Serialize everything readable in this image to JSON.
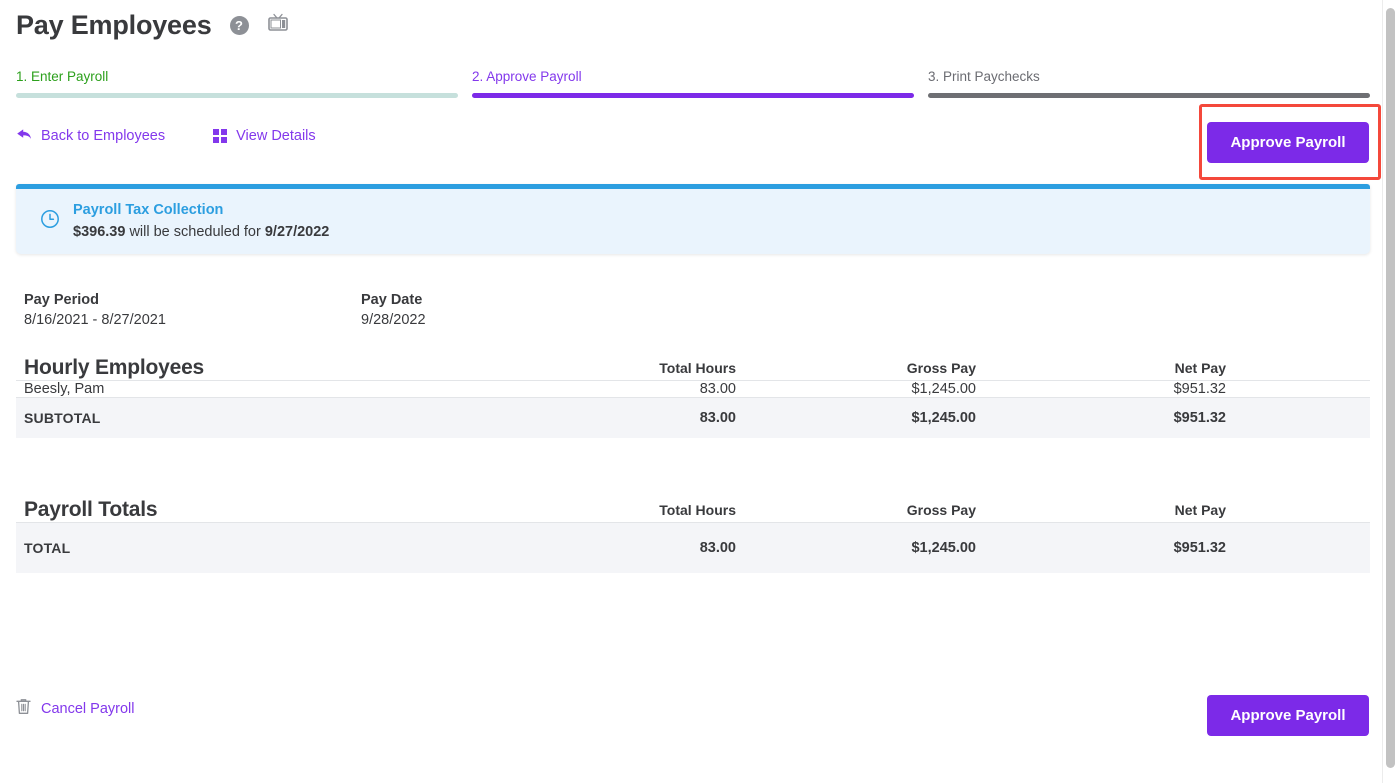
{
  "header": {
    "title": "Pay Employees",
    "help_icon": "help-circle-icon",
    "video_icon": "tutorial-video-icon",
    "help_glyph": "?"
  },
  "steps": [
    {
      "label": "1. Enter Payroll",
      "state": "complete",
      "color": "#2ca01c",
      "bar_color": "#c6e0dc"
    },
    {
      "label": "2. Approve Payroll",
      "state": "current",
      "color": "#8338ec",
      "bar_color": "#7c2ae8"
    },
    {
      "label": "3. Print Paychecks",
      "state": "upcoming",
      "color": "#6b6c72",
      "bar_color": "#6e6f73"
    }
  ],
  "action_bar": {
    "back_label": "Back to Employees",
    "back_icon": "back-arrow-icon",
    "view_details_label": "View Details",
    "view_details_icon": "grid-icon",
    "approve_label": "Approve Payroll"
  },
  "highlight": {
    "target": "approve-payroll-button",
    "color": "#f4483b"
  },
  "banner": {
    "icon": "clock-icon",
    "title": "Payroll Tax Collection",
    "amount": "$396.39",
    "middle_text": " will be scheduled for ",
    "date": "9/27/2022",
    "accent_color": "#2c9ee0",
    "background": "#eaf4fd"
  },
  "pay_info": {
    "period_label": "Pay Period",
    "period_value": "8/16/2021 - 8/27/2021",
    "date_label": "Pay Date",
    "date_value": "9/28/2022"
  },
  "hourly_table": {
    "title": "Hourly Employees",
    "columns": [
      "Total Hours",
      "Gross Pay",
      "Net Pay"
    ],
    "rows": [
      {
        "name": "Beesly, Pam",
        "hours": "83.00",
        "gross": "$1,245.00",
        "net": "$951.32"
      }
    ],
    "subtotal": {
      "name": "SUBTOTAL",
      "hours": "83.00",
      "gross": "$1,245.00",
      "net": "$951.32"
    }
  },
  "totals_table": {
    "title": "Payroll Totals",
    "columns": [
      "Total Hours",
      "Gross Pay",
      "Net Pay"
    ],
    "total": {
      "name": "TOTAL",
      "hours": "83.00",
      "gross": "$1,245.00",
      "net": "$951.32"
    }
  },
  "footer": {
    "cancel_label": "Cancel Payroll",
    "cancel_icon": "trash-icon",
    "approve_label": "Approve Payroll"
  },
  "theme": {
    "purple": "#7c2ae8",
    "link_purple": "#8338ec",
    "green": "#2ca01c",
    "blue": "#2c9ee0",
    "red": "#f4483b"
  }
}
